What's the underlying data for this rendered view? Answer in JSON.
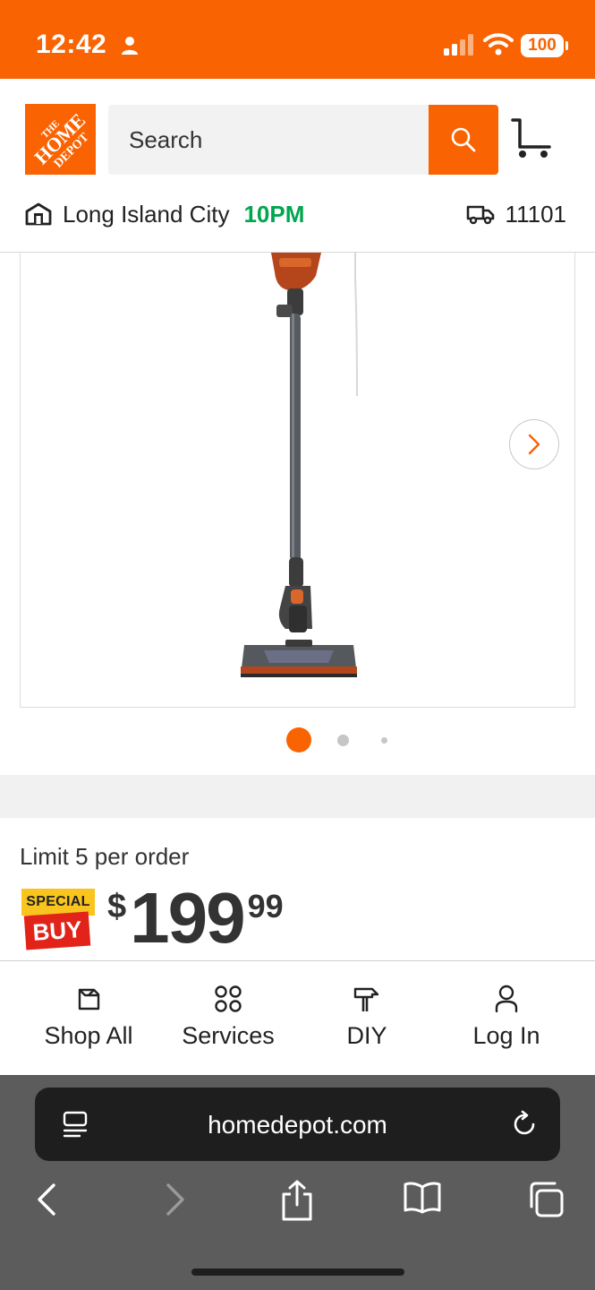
{
  "status_bar": {
    "time": "12:42",
    "battery": "100",
    "background_color": "#f96302"
  },
  "header": {
    "logo_text": [
      "THE",
      "HOME",
      "DEPOT"
    ],
    "search_placeholder": "Search",
    "store_name": "Long Island City",
    "store_close_time": "10PM",
    "delivery_zip": "11101",
    "brand_color": "#f96302",
    "store_time_color": "#00a650"
  },
  "product": {
    "image_icon": "stick-vacuum-image",
    "carousel_total_dots": 3,
    "carousel_active_index": 0,
    "limit_text": "Limit 5 per order",
    "badge_top": "SPECIAL",
    "badge_bottom": "BUY",
    "price_currency": "$",
    "price_dollars": "199",
    "price_cents": "99"
  },
  "bottom_nav": {
    "items": [
      {
        "label": "Shop All",
        "icon": "shop-all-icon"
      },
      {
        "label": "Services",
        "icon": "services-icon"
      },
      {
        "label": "DIY",
        "icon": "diy-icon"
      },
      {
        "label": "Log In",
        "icon": "user-icon"
      }
    ]
  },
  "browser": {
    "url": "homedepot.com"
  }
}
